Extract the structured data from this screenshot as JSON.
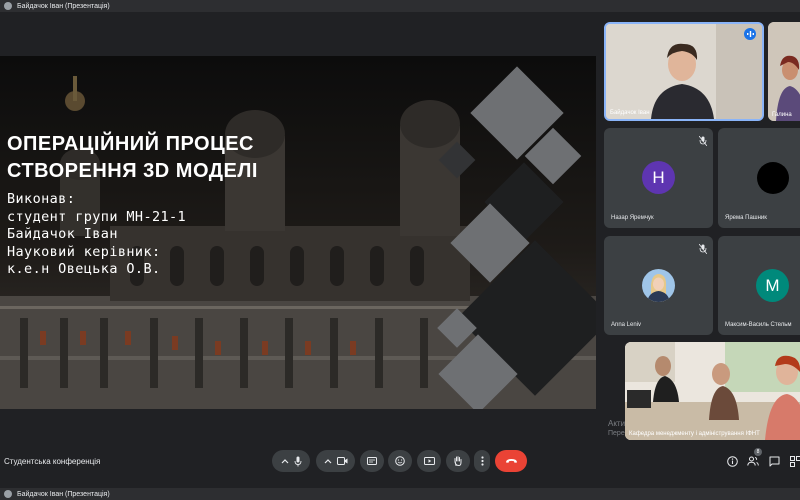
{
  "window": {
    "title": "Байдачок Іван (Презентація)"
  },
  "slide": {
    "title_lines": [
      "ОПЕРАЦІЙНИЙ ПРОЦЕС",
      "СТВОРЕННЯ 3D МОДЕЛІ"
    ],
    "body_lines": [
      "Виконав:",
      "студент групи МН-21-1",
      "Байдачок Іван",
      "Науковий керівник:",
      "к.е.н Овецька О.В."
    ]
  },
  "overlay": {
    "line1": "Акти",
    "line2": "Пере"
  },
  "participants": [
    {
      "name": "Байдачок Іван",
      "type": "video",
      "speaking": true
    },
    {
      "name": "Галина",
      "type": "video"
    },
    {
      "name": "Назар Яремчук",
      "initial": "Н",
      "avatar_color": "#5e35b1",
      "muted": true
    },
    {
      "name": "Ярема Пашник",
      "initial": "",
      "avatar_color": "#000000"
    },
    {
      "name": "Anna Leniv",
      "type": "photo",
      "muted": true
    },
    {
      "name": "Максим-Василь Стельм",
      "initial": "M",
      "avatar_color": "#00897b"
    },
    {
      "name": "Кафедра менеджменту і адміністрування ІФНТ",
      "type": "video"
    }
  ],
  "bottom": {
    "meeting_name": "Студентська конференція",
    "participants_count": "8",
    "end_call_color": "#ea4335"
  },
  "icons": [
    "chevron-up-icon",
    "mic-icon",
    "camera-icon",
    "captions-icon",
    "emoji-icon",
    "present-icon",
    "raise-hand-icon",
    "more-icon",
    "end-call-icon",
    "info-icon",
    "people-icon",
    "chat-icon"
  ]
}
